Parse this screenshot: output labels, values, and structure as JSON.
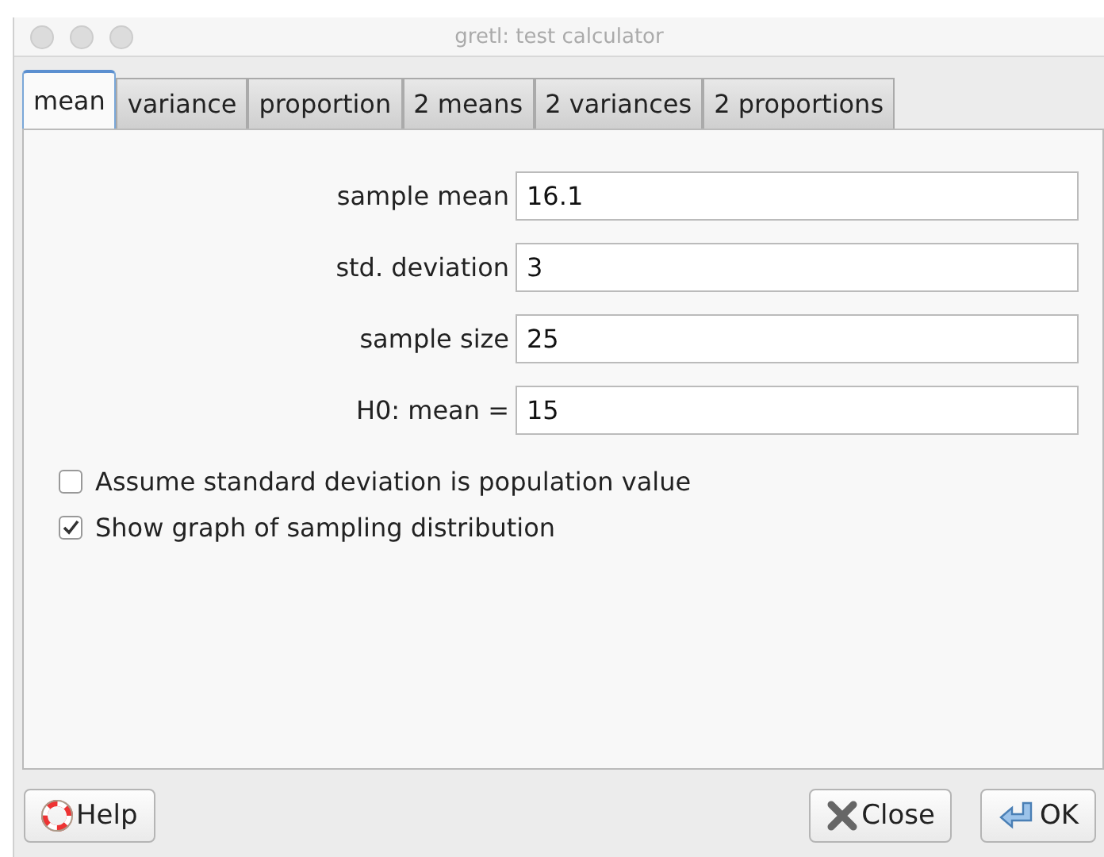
{
  "window": {
    "title": "gretl: test calculator"
  },
  "tabs": [
    {
      "label": "mean",
      "selected": true
    },
    {
      "label": "variance",
      "selected": false
    },
    {
      "label": "proportion",
      "selected": false
    },
    {
      "label": "2 means",
      "selected": false
    },
    {
      "label": "2 variances",
      "selected": false
    },
    {
      "label": "2 proportions",
      "selected": false
    }
  ],
  "fields": [
    {
      "label": "sample mean",
      "value": "16.1"
    },
    {
      "label": "std. deviation",
      "value": "3"
    },
    {
      "label": "sample size",
      "value": "25"
    },
    {
      "label": "H0: mean =",
      "value": "15"
    }
  ],
  "options": [
    {
      "label": "Assume standard deviation is population value",
      "checked": false
    },
    {
      "label": "Show graph of sampling distribution",
      "checked": true
    }
  ],
  "buttons": [
    {
      "label": "Help",
      "kind": "help"
    },
    {
      "label": "Close",
      "kind": "close"
    },
    {
      "label": "OK",
      "kind": "ok"
    }
  ]
}
